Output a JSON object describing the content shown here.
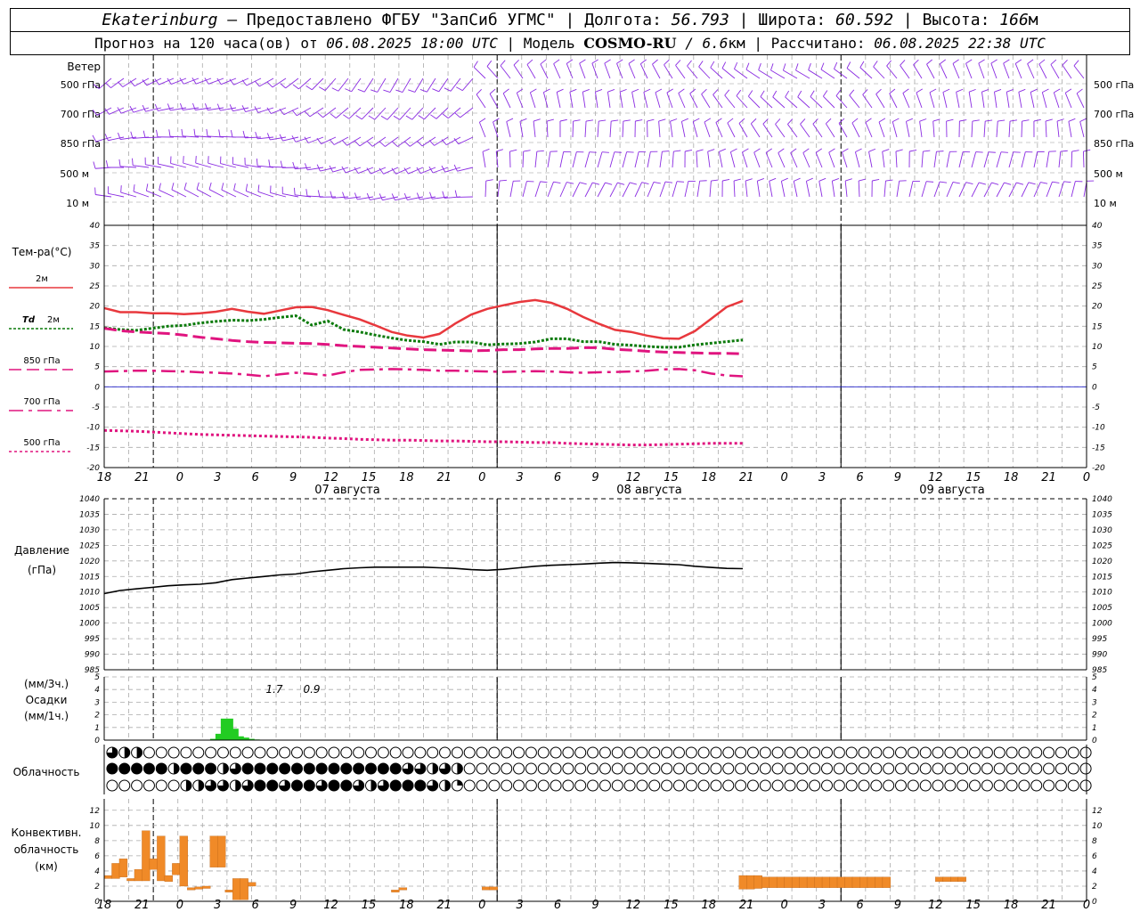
{
  "header": {
    "city": "Ekaterinburg",
    "provider": " – Предоставлено ФГБУ \"ЗапСиб УГМС\"",
    "lon_label": "Долгота:",
    "lon": "56.793",
    "lat_label": "Широта:",
    "lat": "60.592",
    "alt_label": "Высота:",
    "alt": "166",
    "alt_unit": "м",
    "forecast_prefix": "Прогноз на 120 часа(ов) от",
    "forecast_time": "06.08.2025 18:00 UTC",
    "model_label": "| Модель",
    "model": "COSMO-RU",
    "model_res": "/ 6.6",
    "model_res_unit": "км",
    "calc_label": "| Рассчитано:",
    "calc_time": "06.08.2025 22:38 UTC"
  },
  "labels": {
    "wind": "Ветер",
    "levels": [
      "500 гПа",
      "700 гПа",
      "850 гПа",
      "500 м",
      "10  м"
    ],
    "temp": "Тем-ра(°С)",
    "t2m": "2м",
    "td": "Td",
    "td2": "2м",
    "t850": "850 гПа",
    "t700": "700 гПа",
    "t500": "500 гПа",
    "pressure": "Давление",
    "pressure_unit": "(гПа)",
    "precip_unit3": "(мм/3ч.)",
    "precip": "Осадки",
    "precip_unit1": "(мм/1ч.)",
    "cloud": "Облачность",
    "conv1": "Конвективн.",
    "conv2": "облачность",
    "conv3": "(км)"
  },
  "x_ticks": [
    "18",
    "21",
    "0",
    "3",
    "6",
    "9",
    "12",
    "15",
    "18",
    "21",
    "0",
    "3",
    "6",
    "9",
    "12",
    "15",
    "18",
    "21",
    "0",
    "3",
    "6",
    "9",
    "12",
    "15",
    "18",
    "21",
    "0"
  ],
  "dates": [
    "07 августа",
    "08 августа",
    "09 августа"
  ],
  "colors": {
    "wind": "#8a2be2",
    "t2m": "#e8383d",
    "td": "#0a7a0a",
    "t850": "#e0147f",
    "t700": "#e0147f",
    "t500": "#e0147f",
    "precip": "#22cc22",
    "conv": "#f08a28",
    "zero_line": "#2020cc"
  },
  "chart_data": [
    {
      "type": "line",
      "title": "Тем-ра(°С)",
      "x_hours": [
        0,
        3,
        6,
        9,
        12,
        15,
        18,
        21,
        24,
        27,
        30,
        33,
        36,
        39,
        42,
        45,
        48,
        51,
        54,
        57,
        60,
        63,
        66,
        69,
        72,
        75,
        78,
        81,
        84,
        87,
        90,
        93,
        96,
        99,
        102,
        105,
        108,
        111,
        114,
        117,
        120
      ],
      "ylim": [
        -20,
        40
      ],
      "y_ticks": [
        -20,
        -15,
        -10,
        -5,
        0,
        5,
        10,
        15,
        20,
        25,
        30,
        35,
        40
      ],
      "series": [
        {
          "name": "2м",
          "values": [
            19.5,
            18.5,
            18.5,
            18.2,
            18.2,
            18,
            18.2,
            18.6,
            19.3,
            18.6,
            18.1,
            18.9,
            19.7,
            19.8,
            19,
            17.8,
            16.7,
            15.2,
            13.6,
            12.7,
            12.2,
            13.1,
            15.7,
            17.9,
            19.3,
            20.2,
            21,
            21.5,
            20.8,
            19.3,
            17.3,
            15.6,
            14.1,
            13.6,
            12.7,
            12,
            11.9,
            13.8,
            16.8,
            19.8,
            21.3
          ]
        },
        {
          "name": "Td 2м",
          "values": [
            14.6,
            14.2,
            14,
            14.5,
            15,
            15.2,
            15.8,
            16.2,
            16.5,
            16.4,
            16.7,
            17.2,
            17.6,
            15.3,
            16.3,
            14.2,
            13.6,
            12.8,
            12.1,
            11.5,
            11.2,
            10.5,
            11.1,
            11.1,
            10.4,
            10.6,
            10.7,
            11.1,
            11.9,
            11.9,
            11.2,
            11.2,
            10.5,
            10.3,
            10,
            9.8,
            9.8,
            10.4,
            10.8,
            11.2,
            11.6
          ]
        },
        {
          "name": "850 гПа",
          "values": [
            14.5,
            13.9,
            13.6,
            13.4,
            13.2,
            12.8,
            12.3,
            11.9,
            11.5,
            11.2,
            11,
            10.9,
            10.8,
            10.7,
            10.5,
            10.2,
            10,
            9.8,
            9.6,
            9.4,
            9.2,
            9.1,
            9,
            8.9,
            9,
            9.2,
            9.2,
            9.4,
            9.5,
            9.5,
            9.7,
            9.7,
            9.3,
            9.1,
            8.8,
            8.6,
            8.5,
            8.4,
            8.3,
            8.3,
            8.2
          ]
        },
        {
          "name": "700 гПа",
          "values": [
            3.8,
            3.9,
            4,
            4,
            3.9,
            3.8,
            3.6,
            3.5,
            3.3,
            3,
            2.6,
            3.1,
            3.5,
            3.2,
            2.8,
            3.6,
            4.2,
            4.3,
            4.4,
            4.3,
            4.2,
            4,
            4,
            3.9,
            3.8,
            3.7,
            3.8,
            3.9,
            3.8,
            3.6,
            3.5,
            3.6,
            3.7,
            3.8,
            4,
            4.3,
            4.4,
            4.1,
            3.3,
            2.8,
            2.6
          ]
        },
        {
          "name": "500 гПа",
          "values": [
            -10.8,
            -10.9,
            -11,
            -11.2,
            -11.4,
            -11.6,
            -11.8,
            -11.9,
            -12,
            -12.1,
            -12.2,
            -12.3,
            -12.4,
            -12.5,
            -12.7,
            -12.8,
            -13,
            -13.1,
            -13.2,
            -13.2,
            -13.3,
            -13.4,
            -13.4,
            -13.5,
            -13.6,
            -13.6,
            -13.7,
            -13.8,
            -13.8,
            -14,
            -14.1,
            -14.2,
            -14.3,
            -14.4,
            -14.4,
            -14.3,
            -14.2,
            -14.1,
            -14,
            -14,
            -14
          ]
        }
      ]
    },
    {
      "type": "line",
      "title": "Давление (гПа)",
      "x_hours": [
        0,
        3,
        6,
        9,
        12,
        15,
        18,
        21,
        24,
        27,
        30,
        33,
        36,
        39,
        42,
        45,
        48,
        51,
        54,
        57,
        60,
        63,
        66,
        69,
        72,
        75,
        78,
        81,
        84,
        87,
        90,
        93,
        96,
        99,
        102,
        105,
        108,
        111,
        114,
        117,
        120
      ],
      "ylim": [
        985,
        1040
      ],
      "y_ticks": [
        985,
        990,
        995,
        1000,
        1005,
        1010,
        1015,
        1020,
        1025,
        1030,
        1035,
        1040
      ],
      "series": [
        {
          "name": "Давление",
          "values": [
            1009.5,
            1010.5,
            1011,
            1011.5,
            1012,
            1012.3,
            1012.5,
            1013,
            1014,
            1014.5,
            1015,
            1015.5,
            1015.8,
            1016.5,
            1017,
            1017.5,
            1017.8,
            1018,
            1018,
            1018,
            1018,
            1017.8,
            1017.6,
            1017.2,
            1017,
            1017.3,
            1017.8,
            1018.3,
            1018.6,
            1018.8,
            1019,
            1019.3,
            1019.5,
            1019.4,
            1019.2,
            1019,
            1018.8,
            1018.3,
            1017.9,
            1017.6,
            1017.5
          ]
        }
      ]
    },
    {
      "type": "bar",
      "title": "Осадки",
      "ylim": [
        0,
        5
      ],
      "y_ticks": [
        0,
        1,
        2,
        3,
        4,
        5
      ],
      "x_hours": [
        20,
        21,
        22,
        23,
        24,
        25,
        26,
        27,
        28
      ],
      "values": [
        0.1,
        0.5,
        1.7,
        0.9,
        0.3,
        0.2,
        0.1,
        0.05,
        0
      ],
      "annotations": [
        "1.7",
        "0.9"
      ]
    },
    {
      "type": "bar",
      "title": "Конвективн. облачность (км)",
      "ylim": [
        0,
        13
      ],
      "y_ticks": [
        0,
        2,
        4,
        6,
        8,
        10,
        12
      ],
      "bars": [
        {
          "x_hours": 0,
          "bottom": 3,
          "top": 3.4
        },
        {
          "x_hours": 1,
          "bottom": 3,
          "top": 5
        },
        {
          "x_hours": 2,
          "bottom": 3.2,
          "top": 5.6
        },
        {
          "x_hours": 3,
          "bottom": 2.7,
          "top": 3
        },
        {
          "x_hours": 4,
          "bottom": 2.7,
          "top": 4.2
        },
        {
          "x_hours": 5,
          "bottom": 2.7,
          "top": 9.3
        },
        {
          "x_hours": 6,
          "bottom": 4.2,
          "top": 5.6
        },
        {
          "x_hours": 7,
          "bottom": 2.7,
          "top": 8.6
        },
        {
          "x_hours": 8,
          "bottom": 2.6,
          "top": 3.4
        },
        {
          "x_hours": 9,
          "bottom": 3.5,
          "top": 5
        },
        {
          "x_hours": 10,
          "bottom": 2,
          "top": 8.6
        },
        {
          "x_hours": 11,
          "bottom": 1.5,
          "top": 1.8
        },
        {
          "x_hours": 12,
          "bottom": 1.6,
          "top": 1.9
        },
        {
          "x_hours": 13,
          "bottom": 1.7,
          "top": 2
        },
        {
          "x_hours": 14,
          "bottom": 4.5,
          "top": 8.6
        },
        {
          "x_hours": 15,
          "bottom": 4.5,
          "top": 8.6
        },
        {
          "x_hours": 16,
          "bottom": 1.2,
          "top": 1.5
        },
        {
          "x_hours": 17,
          "bottom": 0.2,
          "top": 3
        },
        {
          "x_hours": 18,
          "bottom": 0.2,
          "top": 3
        },
        {
          "x_hours": 19,
          "bottom": 2,
          "top": 2.5
        },
        {
          "x_hours": 38,
          "bottom": 1.2,
          "top": 1.5
        },
        {
          "x_hours": 39,
          "bottom": 1.5,
          "top": 1.8
        },
        {
          "x_hours": 50,
          "bottom": 1.5,
          "top": 1.9
        },
        {
          "x_hours": 51,
          "bottom": 1.5,
          "top": 1.9
        },
        {
          "x_hours": 84,
          "bottom": 1.6,
          "top": 3.4
        },
        {
          "x_hours": 85,
          "bottom": 1.6,
          "top": 3.4
        },
        {
          "x_hours": 86,
          "bottom": 1.7,
          "top": 3.4
        },
        {
          "x_hours": 87,
          "bottom": 1.8,
          "top": 3.2
        },
        {
          "x_hours": 88,
          "bottom": 1.8,
          "top": 3.2
        },
        {
          "x_hours": 89,
          "bottom": 1.8,
          "top": 3.2
        },
        {
          "x_hours": 90,
          "bottom": 1.8,
          "top": 3.2
        },
        {
          "x_hours": 91,
          "bottom": 1.8,
          "top": 3.2
        },
        {
          "x_hours": 92,
          "bottom": 1.8,
          "top": 3.2
        },
        {
          "x_hours": 93,
          "bottom": 1.8,
          "top": 3.2
        },
        {
          "x_hours": 94,
          "bottom": 1.8,
          "top": 3.2
        },
        {
          "x_hours": 95,
          "bottom": 1.8,
          "top": 3.2
        },
        {
          "x_hours": 96,
          "bottom": 1.8,
          "top": 3.2
        },
        {
          "x_hours": 97,
          "bottom": 1.8,
          "top": 3.2
        },
        {
          "x_hours": 98,
          "bottom": 1.8,
          "top": 3.2
        },
        {
          "x_hours": 99,
          "bottom": 1.8,
          "top": 3.2
        },
        {
          "x_hours": 100,
          "bottom": 1.8,
          "top": 3.2
        },
        {
          "x_hours": 101,
          "bottom": 1.8,
          "top": 3.2
        },
        {
          "x_hours": 102,
          "bottom": 1.8,
          "top": 3.2
        },
        {
          "x_hours": 103,
          "bottom": 1.8,
          "top": 3.2
        },
        {
          "x_hours": 110,
          "bottom": 2.6,
          "top": 3.2
        },
        {
          "x_hours": 111,
          "bottom": 2.6,
          "top": 3.2
        },
        {
          "x_hours": 112,
          "bottom": 2.6,
          "top": 3.2
        },
        {
          "x_hours": 113,
          "bottom": 2.6,
          "top": 3.2
        }
      ]
    }
  ],
  "cloud_rows": {
    "top": [
      3,
      2,
      2,
      0,
      0,
      0,
      0,
      0,
      0,
      0,
      0,
      0,
      0,
      0,
      0,
      0,
      0,
      0,
      0,
      0,
      0,
      0,
      0,
      0,
      0,
      0,
      0,
      0,
      0,
      0,
      0,
      0,
      0,
      0,
      0,
      0,
      0,
      0,
      0,
      0,
      0,
      0,
      0,
      0,
      0,
      0,
      0,
      0,
      0,
      0,
      0,
      0,
      0,
      0,
      0,
      0,
      0,
      0,
      0,
      0,
      0,
      0,
      0,
      0,
      0,
      0,
      0,
      0,
      0,
      0,
      0,
      0,
      0,
      0,
      0,
      0,
      0,
      0,
      0,
      0,
      0,
      0,
      0,
      0,
      0,
      0,
      0,
      0,
      0,
      0,
      0,
      0,
      0,
      0,
      0,
      0,
      0,
      0,
      0,
      0,
      0,
      0,
      0,
      0,
      0,
      0,
      0,
      0,
      0,
      0,
      0,
      0,
      0,
      0,
      0,
      0,
      0,
      0,
      0,
      0,
      0,
      0,
      0,
      0,
      0,
      0,
      0,
      0,
      0,
      0,
      0,
      0,
      0,
      0,
      0,
      0,
      0,
      0,
      0,
      0,
      0,
      0,
      0,
      0,
      0,
      0,
      0,
      0,
      0,
      0
    ],
    "mid": [
      4,
      4,
      4,
      4,
      4,
      2,
      4,
      4,
      4,
      2,
      3,
      4,
      4,
      4,
      4,
      4,
      4,
      4,
      4,
      4,
      4,
      4,
      4,
      4,
      3,
      3,
      2,
      3,
      2,
      0,
      0,
      0,
      0,
      0,
      0,
      0,
      0,
      0,
      0,
      0,
      0,
      0,
      0,
      0,
      0,
      0,
      0,
      0,
      0,
      0,
      0,
      0,
      0,
      0,
      0,
      0,
      0,
      0,
      0,
      0,
      0,
      0,
      0,
      0,
      0,
      0,
      0,
      0,
      0,
      0,
      0,
      0,
      0,
      0,
      0,
      0,
      0,
      0,
      0,
      0,
      0,
      0,
      0,
      0,
      0,
      0,
      0,
      0,
      0,
      0,
      0,
      0,
      0,
      0,
      0,
      0,
      0,
      0,
      0,
      0,
      0,
      0,
      0,
      0,
      0,
      0,
      0,
      0,
      0,
      0,
      0,
      0,
      0,
      0,
      0,
      0,
      0,
      0,
      0,
      0,
      0,
      0,
      0,
      0,
      0,
      0,
      0,
      0,
      0,
      0,
      0,
      0,
      0,
      0,
      0,
      0,
      0,
      0,
      0,
      0,
      0,
      0,
      0,
      0,
      0,
      0,
      0,
      0,
      0,
      0
    ],
    "low": [
      0,
      0,
      0,
      0,
      0,
      0,
      2,
      2,
      3,
      3,
      2,
      3,
      4,
      4,
      3,
      4,
      4,
      3,
      4,
      4,
      3,
      2,
      3,
      4,
      4,
      4,
      3,
      2,
      1,
      0,
      0,
      0,
      0,
      0,
      0,
      0,
      0,
      0,
      0,
      0,
      0,
      0,
      0,
      0,
      0,
      0,
      0,
      0,
      0,
      0,
      0,
      0,
      0,
      0,
      0,
      0,
      0,
      0,
      0,
      0,
      0,
      0,
      0,
      0,
      0,
      0,
      0,
      0,
      0,
      0,
      0,
      0,
      0,
      0,
      0,
      0,
      0,
      0,
      0,
      0,
      0,
      0,
      0,
      0,
      0,
      0,
      0,
      0,
      0,
      0,
      0,
      0,
      0,
      0,
      0,
      0,
      0,
      0,
      0,
      0,
      0,
      0,
      0,
      0,
      0,
      0,
      0,
      0,
      0,
      0,
      0,
      0,
      0,
      0,
      0,
      0,
      0,
      0,
      0,
      0,
      0,
      0,
      0,
      0,
      0,
      0,
      0,
      0,
      0,
      0,
      0,
      0,
      0,
      0,
      0,
      0,
      0,
      0,
      0,
      0,
      0,
      0,
      0,
      0,
      0,
      0,
      0,
      0,
      0,
      0
    ]
  }
}
